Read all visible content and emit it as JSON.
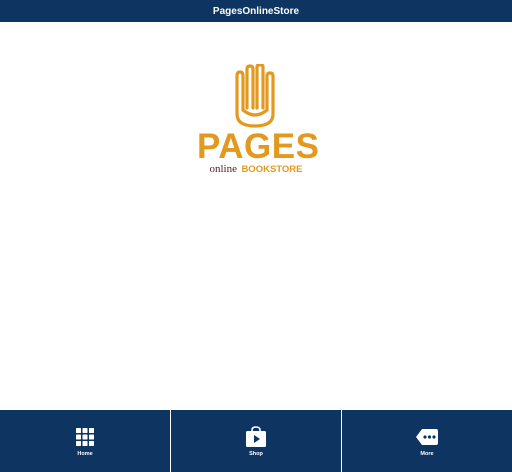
{
  "header": {
    "title": "PagesOnlineStore"
  },
  "logo": {
    "brand": "PAGES",
    "online": "online",
    "bookstore": "BOOKSTORE"
  },
  "colors": {
    "nav_background": "#0e3461",
    "brand_orange": "#e3991e",
    "brand_maroon": "#5a1a1a",
    "background": "#ffffff"
  },
  "tabs": [
    {
      "label": "Home",
      "icon": "grid-icon"
    },
    {
      "label": "Shop",
      "icon": "shopping-bag-icon"
    },
    {
      "label": "More",
      "icon": "more-tag-icon"
    }
  ]
}
